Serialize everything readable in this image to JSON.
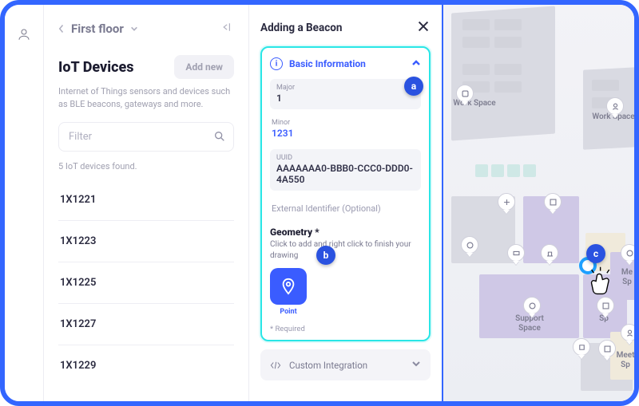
{
  "callouts": {
    "a": "a",
    "b": "b",
    "c": "c"
  },
  "left": {
    "breadcrumb": "First floor",
    "section_title": "IoT Devices",
    "add_button": "Add new",
    "description": "Internet of Things sensors and devices such as BLE beacons, gateways and more.",
    "filter_placeholder": "Filter",
    "found_text": "5 IoT devices found.",
    "devices": [
      "1X1221",
      "1X1223",
      "1X1225",
      "1X1227",
      "1X1229"
    ]
  },
  "mid": {
    "title": "Adding a Beacon",
    "card_title": "Basic Information",
    "major_label": "Major",
    "major_value": "1",
    "minor_label": "Minor",
    "minor_value": "1231",
    "uuid_label": "UUID",
    "uuid_value": "AAAAAAA0-BBB0-CCC0-DDD0-4A550",
    "ext_id_placeholder": "External Identifier (Optional)",
    "geometry_title": "Geometry *",
    "geometry_desc": "Click to add and right click to finish your drawing",
    "point_label": "Point",
    "required_note": "* Required",
    "custom_integration": "Custom Integration"
  },
  "map": {
    "labels": {
      "work_space_left": "Work Space",
      "work_space_right": "Work Space",
      "support_space": "Support\nSpace",
      "meet_right_1": "Me\nSp",
      "meet_right_2": "Meet\nSp",
      "meet_bottom": "Sp"
    }
  }
}
